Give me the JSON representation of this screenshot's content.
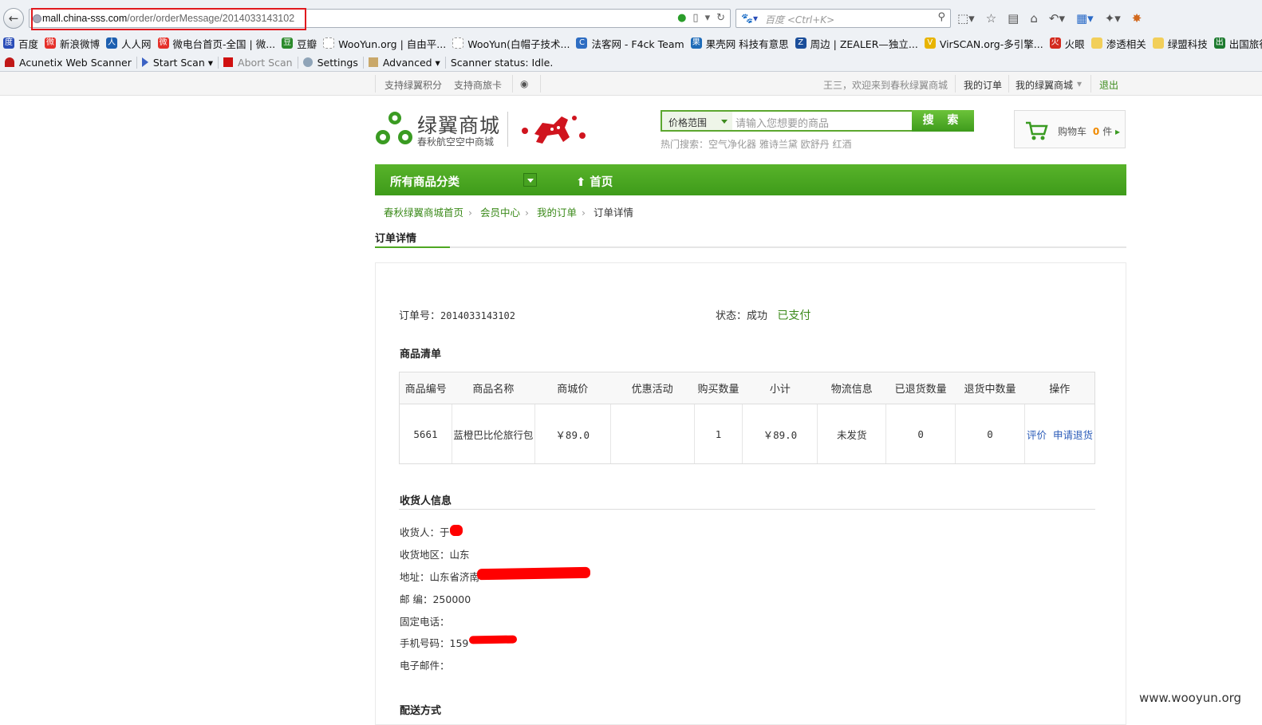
{
  "browser": {
    "url_host": "mall.china-sss.com",
    "url_path": "/order/orderMessage/2014033143102",
    "search_placeholder": "百度 <Ctrl+K>",
    "bookmarks": [
      "百度",
      "新浪微博",
      "人人网",
      "微电台首页-全国 | 微...",
      "豆瓣",
      "WooYun.org | 自由平...",
      "WooYun(白帽子技术...",
      "法客网 - F4ck Team",
      "果壳网 科技有意思",
      "周边 | ZEALER—独立...",
      "VirSCAN.org-多引擎...",
      "火眼",
      "渗透相关",
      "绿盟科技",
      "出国旅行目的"
    ],
    "acunetix": {
      "title": "Acunetix Web Scanner",
      "start": "Start Scan ▾",
      "abort": "Abort Scan",
      "settings": "Settings",
      "advanced": "Advanced ▾",
      "status": "Scanner status: Idle."
    }
  },
  "topbar": {
    "left": [
      "支持绿翼积分",
      "支持商旅卡"
    ],
    "welcome": "王三，欢迎来到春秋绿翼商城",
    "my_orders": "我的订单",
    "my_mall": "我的绿翼商城",
    "logout": "退出"
  },
  "header": {
    "logo_title": "绿翼商城",
    "logo_sub": "春秋航空空中商城",
    "price_range": "价格范围",
    "search_placeholder": "请输入您想要的商品",
    "search_button": "搜 索",
    "hot_search": "热门搜索：空气净化器  雅诗兰黛  欧舒丹  红酒",
    "cart_label": "购物车",
    "cart_count": "0",
    "cart_unit": "件"
  },
  "nav": {
    "all_categories": "所有商品分类",
    "home": "首页"
  },
  "breadcrumb": [
    "春秋绿翼商城首页",
    "会员中心",
    "我的订单",
    "订单详情"
  ],
  "page_title": "订单详情",
  "order": {
    "number_label": "订单号：",
    "number": "2014033143102",
    "status_label": "状态：成功",
    "paid": "已支付"
  },
  "items_section": "商品清单",
  "items_headers": [
    "商品编号",
    "商品名称",
    "商城价",
    "优惠活动",
    "购买数量",
    "小计",
    "物流信息",
    "已退货数量",
    "退货中数量",
    "操作"
  ],
  "items": [
    {
      "id": "5661",
      "name": "蓝橙巴比伦旅行包",
      "price": "￥89.0",
      "promo": "",
      "qty": "1",
      "subtotal": "￥89.0",
      "logistics": "未发货",
      "returned": "0",
      "returning": "0",
      "op1": "评价",
      "op2": "申请退货"
    }
  ],
  "receiver_section": "收货人信息",
  "receiver": {
    "name": "收货人：于",
    "region": "收货地区：山东",
    "address": "地址：山东省济南",
    "zip": "邮  编：250000",
    "phone": "固定电话：",
    "mobile": "手机号码：159",
    "email": "电子邮件："
  },
  "delivery_section": "配送方式",
  "watermark": "www.wooyun.org",
  "colors": {
    "accent": "#4ea722",
    "highlight": "#e0191e",
    "link": "#2a5bb8"
  }
}
